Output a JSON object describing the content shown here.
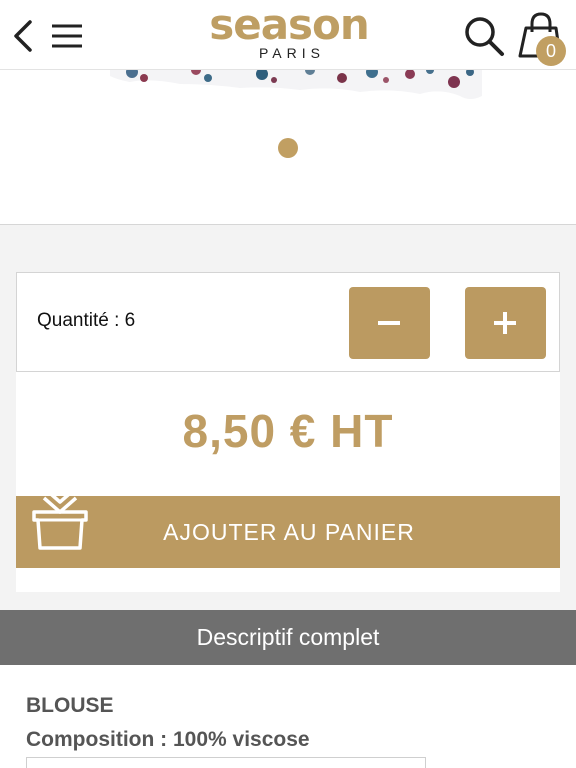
{
  "header": {
    "logo_main": "season",
    "logo_sub": "PARIS",
    "cart_count": "0",
    "back_icon": "chevron-left-icon",
    "menu_icon": "hamburger-icon",
    "search_icon": "search-icon",
    "cart_icon": "shopping-bag-icon"
  },
  "product": {
    "quantity_label": "Quantité : 6",
    "price": "8,50 € HT",
    "add_to_cart_label": "AJOUTER AU PANIER"
  },
  "description": {
    "section_title": "Descriptif complet",
    "type": "BLOUSE",
    "composition": "Composition : 100% viscose"
  },
  "colors": {
    "accent": "#bb9a61",
    "description_bar": "#6f6f6f",
    "background_gray": "#f3f3f3"
  }
}
